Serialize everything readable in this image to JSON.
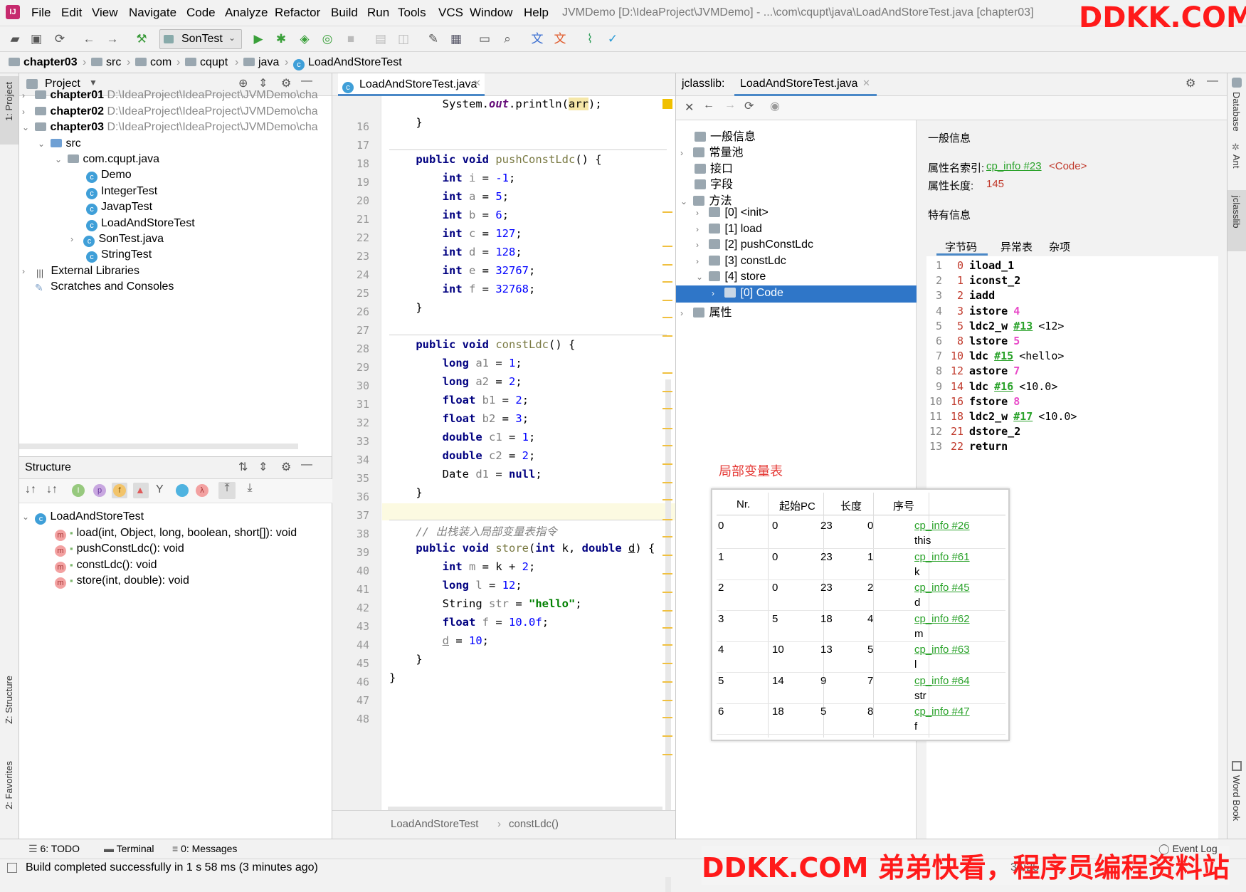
{
  "menu": {
    "items": [
      "File",
      "Edit",
      "View",
      "Navigate",
      "Code",
      "Analyze",
      "Refactor",
      "Build",
      "Run",
      "Tools",
      "VCS",
      "Window",
      "Help"
    ],
    "window_title": "JVMDemo [D:\\IdeaProject\\JVMDemo] - ...\\com\\cqupt\\java\\LoadAndStoreTest.java [chapter03]"
  },
  "toolbar": {
    "run_config": "SonTest"
  },
  "breadcrumb": [
    "chapter03",
    "src",
    "com",
    "cqupt",
    "java",
    "LoadAndStoreTest"
  ],
  "side_tabs": {
    "project": "1: Project",
    "structure": "Z: Structure",
    "favorites": "2: Favorites",
    "database": "Database",
    "ant": "Ant",
    "jclasslib": "jclasslib",
    "wordbook": "Word Book"
  },
  "project": {
    "title": "Project",
    "items": [
      {
        "name": "chapter01",
        "path": "D:\\IdeaProject\\IdeaProject\\JVMDemo\\cha"
      },
      {
        "name": "chapter02",
        "path": "D:\\IdeaProject\\IdeaProject\\JVMDemo\\cha"
      },
      {
        "name": "chapter03",
        "path": "D:\\IdeaProject\\IdeaProject\\JVMDemo\\cha"
      },
      {
        "name": "src"
      },
      {
        "name": "com.cqupt.java"
      },
      {
        "name": "Demo"
      },
      {
        "name": "IntegerTest"
      },
      {
        "name": "JavapTest"
      },
      {
        "name": "LoadAndStoreTest"
      },
      {
        "name": "SonTest.java"
      },
      {
        "name": "StringTest"
      },
      {
        "name": "External Libraries"
      },
      {
        "name": "Scratches and Consoles"
      }
    ]
  },
  "structure": {
    "title": "Structure",
    "root": "LoadAndStoreTest",
    "methods": [
      "load(int, Object, long, boolean, short[]): void",
      "pushConstLdc(): void",
      "constLdc(): void",
      "store(int, double): void"
    ]
  },
  "editor": {
    "tab": "LoadAndStoreTest.java",
    "line_numbers": [
      "16",
      "17",
      "18",
      "19",
      "20",
      "21",
      "22",
      "23",
      "24",
      "25",
      "26",
      "27",
      "28",
      "29",
      "30",
      "31",
      "32",
      "33",
      "34",
      "35",
      "36",
      "37",
      "38",
      "39",
      "40",
      "41",
      "42",
      "43",
      "44",
      "45",
      "46",
      "47",
      "48"
    ],
    "footer_class": "LoadAndStoreTest",
    "footer_method": "constLdc()"
  },
  "jclasslib": {
    "label": "jclasslib:",
    "tab": "LoadAndStoreTest.java",
    "tree": [
      "一般信息",
      "常量池",
      "接口",
      "字段",
      "方法",
      "[0] <init>",
      "[1] load",
      "[2] pushConstLdc",
      "[3] constLdc",
      "[4] store",
      "[0] Code",
      "属性"
    ],
    "general_title": "一般信息",
    "attr_name_label": "属性名索引:",
    "attr_name_link": "cp_info #23",
    "attr_name_value": "<Code>",
    "attr_len_label": "属性长度:",
    "attr_len_value": "145",
    "specific_title": "特有信息",
    "subtabs": [
      "字节码",
      "异常表",
      "杂项"
    ],
    "bytecode": [
      {
        "n": "1",
        "pc": "0",
        "op": "iload_1",
        "arg": ""
      },
      {
        "n": "2",
        "pc": "1",
        "op": "iconst_2",
        "arg": ""
      },
      {
        "n": "3",
        "pc": "2",
        "op": "iadd",
        "arg": ""
      },
      {
        "n": "4",
        "pc": "3",
        "op": "istore",
        "arg": "4"
      },
      {
        "n": "5",
        "pc": "5",
        "op": "ldc2_w",
        "link": "#13",
        "arg": "<12>"
      },
      {
        "n": "6",
        "pc": "8",
        "op": "lstore",
        "arg": "5"
      },
      {
        "n": "7",
        "pc": "10",
        "op": "ldc",
        "link": "#15",
        "arg": "<hello>"
      },
      {
        "n": "8",
        "pc": "12",
        "op": "astore",
        "arg": "7"
      },
      {
        "n": "9",
        "pc": "14",
        "op": "ldc",
        "link": "#16",
        "arg": "<10.0>"
      },
      {
        "n": "10",
        "pc": "16",
        "op": "fstore",
        "arg": "8"
      },
      {
        "n": "11",
        "pc": "18",
        "op": "ldc2_w",
        "link": "#17",
        "arg": "<10.0>"
      },
      {
        "n": "12",
        "pc": "21",
        "op": "dstore_2",
        "arg": ""
      },
      {
        "n": "13",
        "pc": "22",
        "op": "return",
        "arg": ""
      }
    ]
  },
  "local_var_table": {
    "caption": "局部变量表",
    "headers": [
      "Nr.",
      "起始PC",
      "长度",
      "序号",
      ""
    ],
    "rows": [
      [
        "0",
        "0",
        "23",
        "0",
        "cp_info #26",
        "this"
      ],
      [
        "1",
        "0",
        "23",
        "1",
        "cp_info #61",
        "k"
      ],
      [
        "2",
        "0",
        "23",
        "2",
        "cp_info #45",
        "d"
      ],
      [
        "3",
        "5",
        "18",
        "4",
        "cp_info #62",
        "m"
      ],
      [
        "4",
        "10",
        "13",
        "5",
        "cp_info #63",
        "l"
      ],
      [
        "5",
        "14",
        "9",
        "7",
        "cp_info #64",
        "str"
      ],
      [
        "6",
        "18",
        "5",
        "8",
        "cp_info #47",
        "f"
      ]
    ]
  },
  "bottom_tabs": [
    "6: TODO",
    "Terminal",
    "0: Messages"
  ],
  "event_log": "Event Log",
  "status": {
    "text": "Build completed successfully in 1 s 58 ms (3 minutes ago)",
    "position": "34:25"
  },
  "watermarks": {
    "top": "DDKK.COM",
    "bottom": "DDKK.COM 弟弟快看，程序员编程资料站"
  }
}
